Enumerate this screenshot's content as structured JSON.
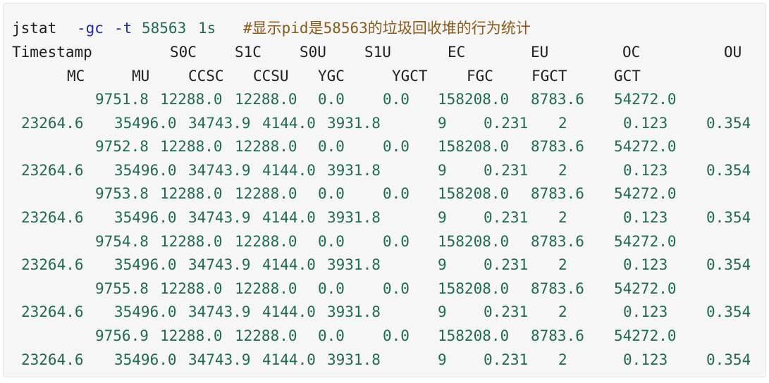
{
  "command": {
    "name": "jstat",
    "flag": "-gc",
    "flag2": "-t",
    "pid": "58563",
    "interval": "1s",
    "comment": "#显示pid是58563的垃圾回收堆的行为统计"
  },
  "header_row1": [
    "Timestamp",
    "S0C",
    "S1C",
    "S0U",
    "S1U",
    "EC",
    "EU",
    "OC",
    "OU"
  ],
  "header_row2": [
    "MC",
    "MU",
    "CCSC",
    "CCSU",
    "YGC",
    "YGCT",
    "FGC",
    "FGCT",
    "GCT"
  ],
  "rows": [
    {
      "a": [
        "9751.8",
        "12288.0",
        "12288.0",
        "0.0",
        "0.0",
        "158208.0",
        "8783.6",
        "54272.0"
      ],
      "b": [
        "23264.6",
        "35496.0",
        "34743.9",
        "4144.0",
        "3931.8",
        "9",
        "0.231",
        "2",
        "0.123",
        "0.354"
      ]
    },
    {
      "a": [
        "9752.8",
        "12288.0",
        "12288.0",
        "0.0",
        "0.0",
        "158208.0",
        "8783.6",
        "54272.0"
      ],
      "b": [
        "23264.6",
        "35496.0",
        "34743.9",
        "4144.0",
        "3931.8",
        "9",
        "0.231",
        "2",
        "0.123",
        "0.354"
      ]
    },
    {
      "a": [
        "9753.8",
        "12288.0",
        "12288.0",
        "0.0",
        "0.0",
        "158208.0",
        "8783.6",
        "54272.0"
      ],
      "b": [
        "23264.6",
        "35496.0",
        "34743.9",
        "4144.0",
        "3931.8",
        "9",
        "0.231",
        "2",
        "0.123",
        "0.354"
      ]
    },
    {
      "a": [
        "9754.8",
        "12288.0",
        "12288.0",
        "0.0",
        "0.0",
        "158208.0",
        "8783.6",
        "54272.0"
      ],
      "b": [
        "23264.6",
        "35496.0",
        "34743.9",
        "4144.0",
        "3931.8",
        "9",
        "0.231",
        "2",
        "0.123",
        "0.354"
      ]
    },
    {
      "a": [
        "9755.8",
        "12288.0",
        "12288.0",
        "0.0",
        "0.0",
        "158208.0",
        "8783.6",
        "54272.0"
      ],
      "b": [
        "23264.6",
        "35496.0",
        "34743.9",
        "4144.0",
        "3931.8",
        "9",
        "0.231",
        "2",
        "0.123",
        "0.354"
      ]
    },
    {
      "a": [
        "9756.9",
        "12288.0",
        "12288.0",
        "0.0",
        "0.0",
        "158208.0",
        "8783.6",
        "54272.0"
      ],
      "b": [
        "23264.6",
        "35496.0",
        "34743.9",
        "4144.0",
        "3931.8",
        "9",
        "0.231",
        "2",
        "0.123",
        "0.354"
      ]
    }
  ]
}
